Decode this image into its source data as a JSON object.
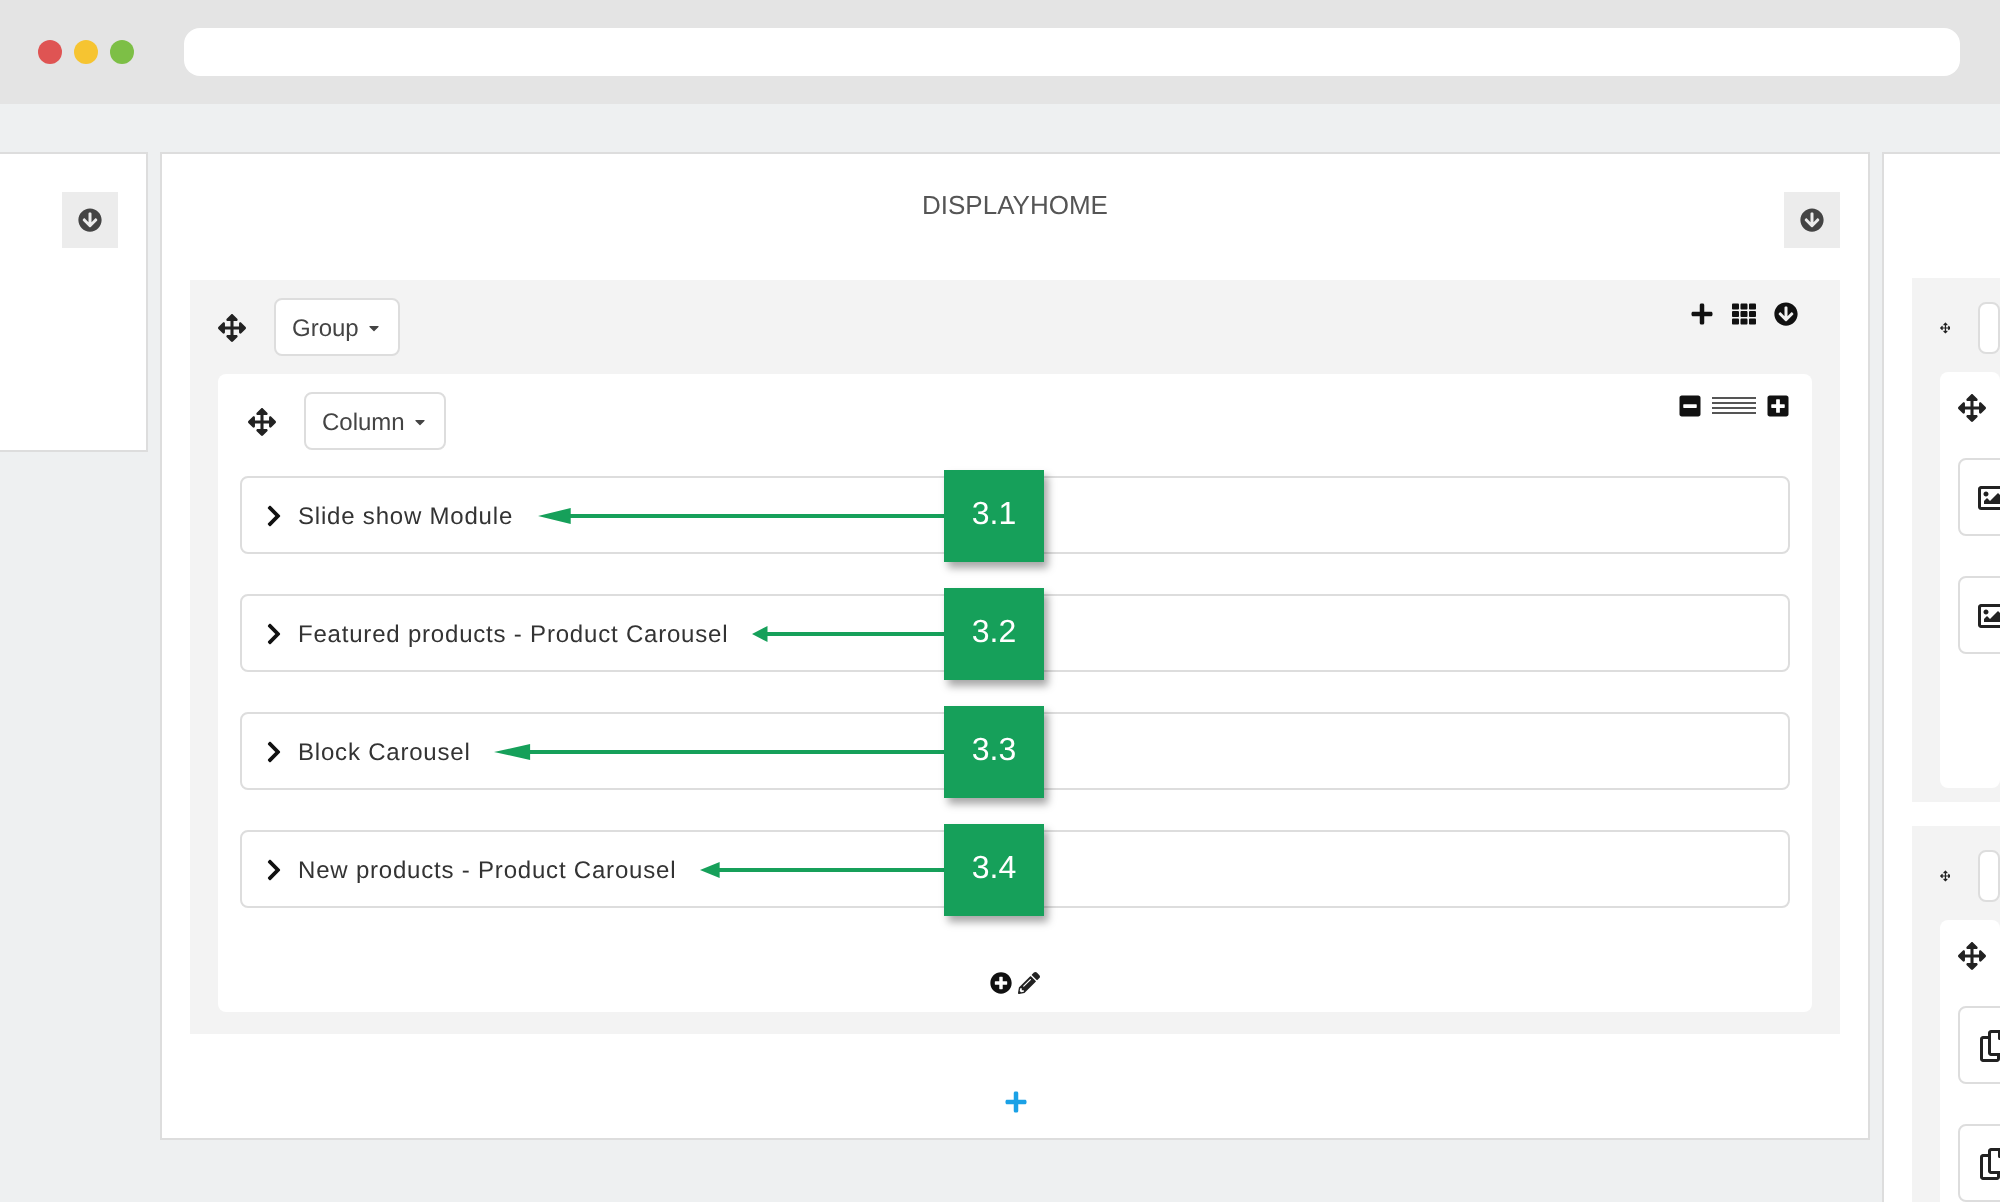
{
  "hook": {
    "title": "DISPLAYHOME"
  },
  "group": {
    "label": "Group"
  },
  "column": {
    "label": "Column"
  },
  "modules": [
    {
      "label": "Slide show Module",
      "callout": "3.1"
    },
    {
      "label": "Featured products - Product Carousel",
      "callout": "3.2"
    },
    {
      "label": "Block Carousel",
      "callout": "3.3"
    },
    {
      "label": "New products - Product Carousel",
      "callout": "3.4"
    }
  ],
  "right_groups": [
    {
      "items": [
        {
          "kind": "image"
        },
        {
          "kind": "image"
        }
      ]
    },
    {
      "items": [
        {
          "kind": "copy"
        },
        {
          "kind": "copy"
        }
      ]
    }
  ]
}
